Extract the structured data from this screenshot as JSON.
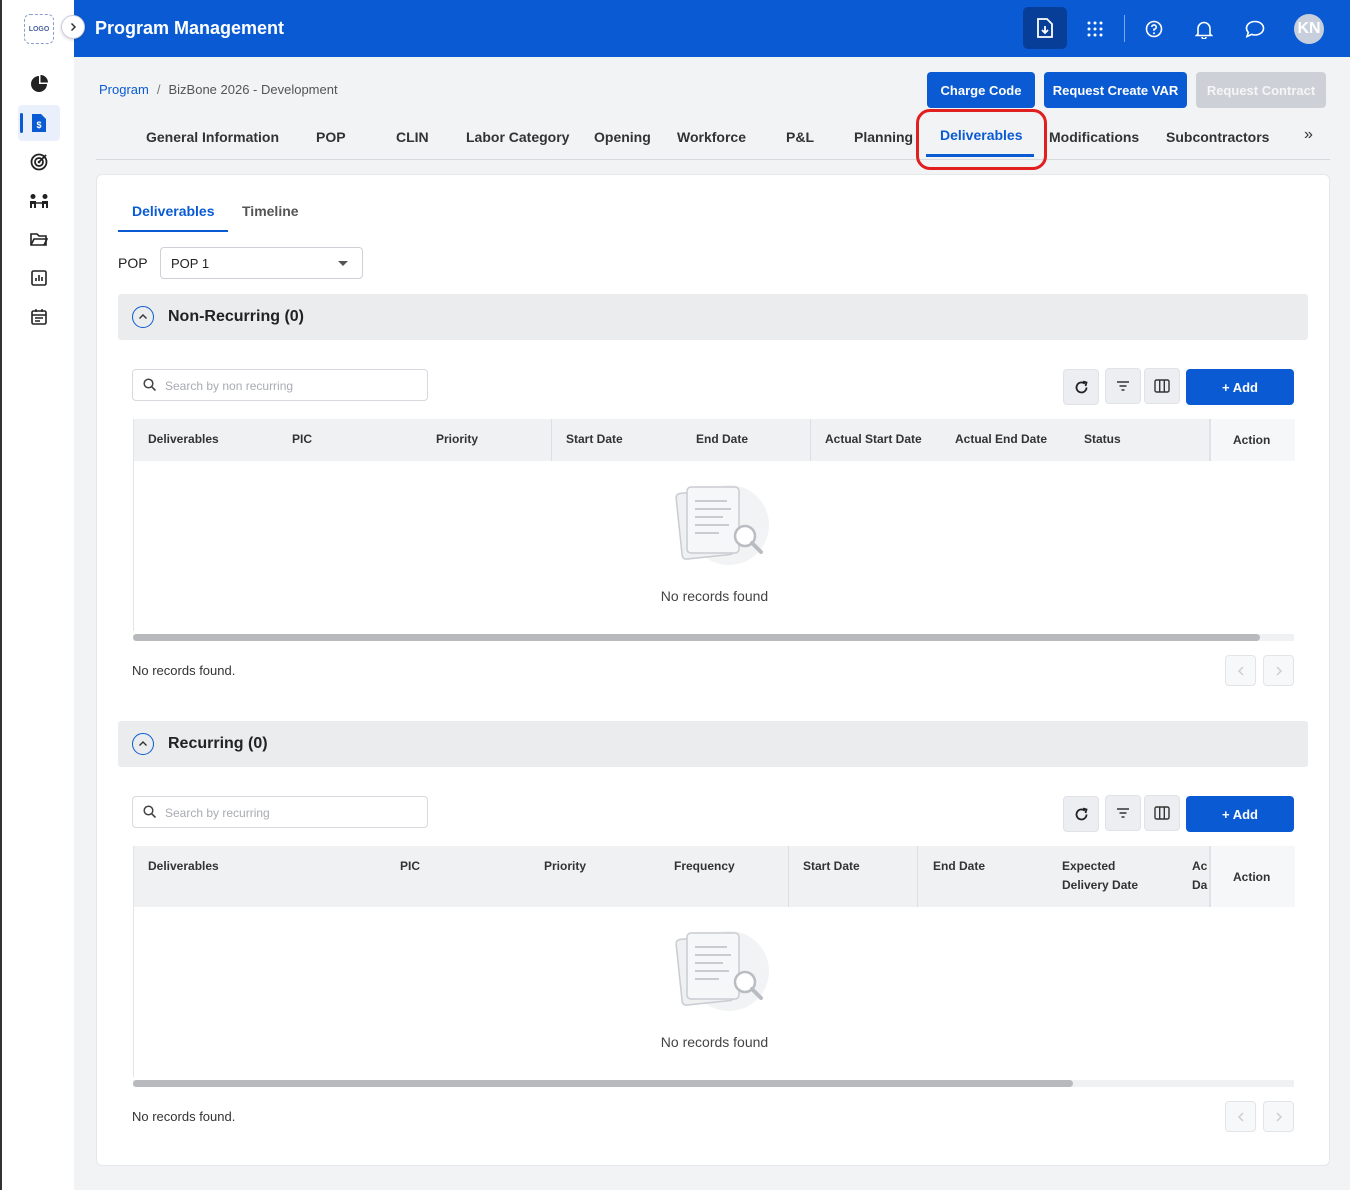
{
  "app": {
    "title": "Program Management",
    "logo": "LOGO",
    "avatar_initials": "KN"
  },
  "sidebar": {
    "items": [
      {
        "icon": "pie-chart-icon"
      },
      {
        "icon": "program-budget-icon",
        "active": true
      },
      {
        "icon": "target-icon"
      },
      {
        "icon": "team-icon"
      },
      {
        "icon": "folder-icon"
      },
      {
        "icon": "report-icon"
      },
      {
        "icon": "calendar-icon"
      }
    ]
  },
  "breadcrumb": {
    "root": "Program",
    "separator": "/",
    "current": "BizBone 2026 - Development"
  },
  "header_buttons": {
    "charge_code": "Charge Code",
    "request_var": "Request Create VAR",
    "request_contract": "Request Contract"
  },
  "tabs": [
    "General Information",
    "POP",
    "CLIN",
    "Labor Category",
    "Opening",
    "Workforce",
    "P&L",
    "Planning",
    "Deliverables",
    "Modifications",
    "Subcontractors"
  ],
  "tabs_more": "»",
  "subtabs": {
    "deliverables": "Deliverables",
    "timeline": "Timeline"
  },
  "pop": {
    "label": "POP",
    "selected": "POP 1"
  },
  "non_recurring": {
    "title": "Non-Recurring (0)",
    "search_placeholder": "Search by non recurring",
    "add_label": "+ Add",
    "columns": [
      "Deliverables",
      "PIC",
      "Priority",
      "Start Date",
      "End Date",
      "Actual Start Date",
      "Actual End Date",
      "Status"
    ],
    "action_column": "Action",
    "empty_text": "No records found",
    "footer_text": "No records found."
  },
  "recurring": {
    "title": "Recurring (0)",
    "search_placeholder": "Search by recurring",
    "add_label": "+ Add",
    "columns": [
      "Deliverables",
      "PIC",
      "Priority",
      "Frequency",
      "Start Date",
      "End Date",
      "Expected Delivery Date",
      "Ac Da"
    ],
    "action_column": "Action",
    "empty_text": "No records found",
    "footer_text": "No records found."
  },
  "colors": {
    "primary": "#0a5bd3",
    "highlight": "#e21f1f"
  }
}
